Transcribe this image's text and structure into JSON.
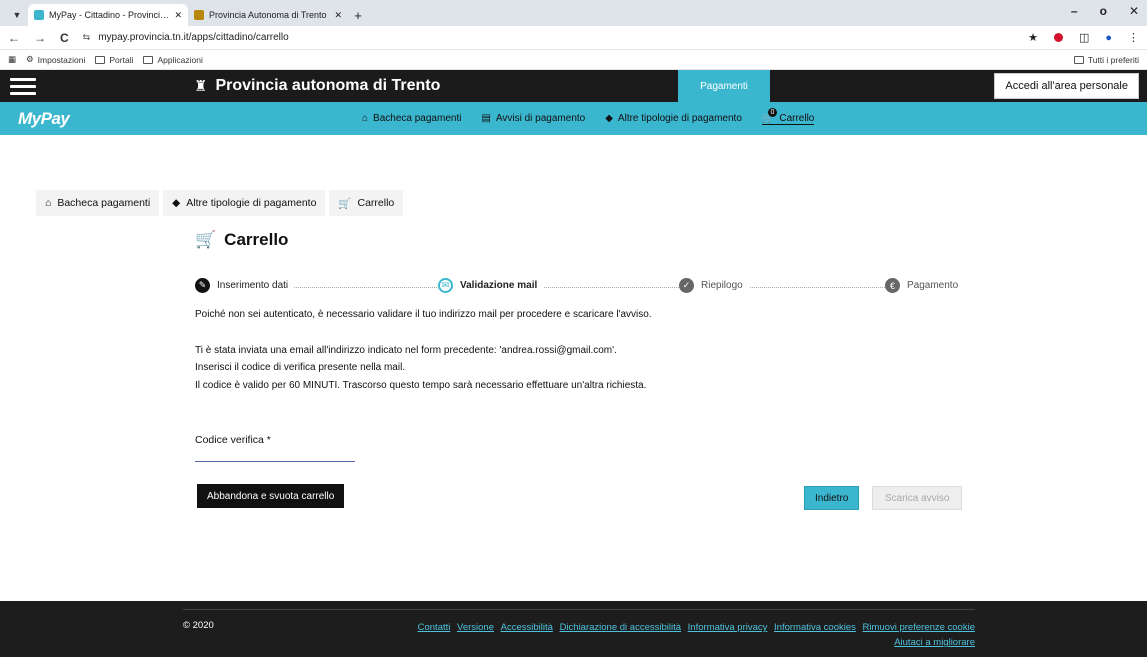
{
  "browser": {
    "tabs": [
      {
        "title": "MyPay - Cittadino - Provincia A",
        "active": true,
        "close": "✕"
      },
      {
        "title": "Provincia Autonoma di Trento",
        "active": false,
        "close": "✕"
      }
    ],
    "new_tab": "+",
    "url": "mypay.provincia.tn.it/apps/cittadino/carrello",
    "bookmarks": [
      {
        "label": "Impostazioni",
        "icon": "gear-icon"
      },
      {
        "label": "Portali",
        "icon": "folder-icon"
      },
      {
        "label": "Applicazioni",
        "icon": "folder-icon"
      }
    ],
    "bookmarks_right": "Tutti i preferiti"
  },
  "header": {
    "title": "Provincia autonoma di Trento",
    "section": "Pagamenti",
    "login": "Accedi all'area personale"
  },
  "mypay": {
    "logo": "MyPay",
    "nav": [
      {
        "label": "Bacheca pagamenti",
        "icon": "home-icon"
      },
      {
        "label": "Avvisi di pagamento",
        "icon": "document-icon"
      },
      {
        "label": "Altre tipologie di pagamento",
        "icon": "tag-icon"
      },
      {
        "label": "Carrello",
        "icon": "cart-icon",
        "badge": "0"
      }
    ]
  },
  "breadcrumb": [
    {
      "label": "Bacheca pagamenti",
      "icon": "home-icon"
    },
    {
      "label": "Altre tipologie di pagamento",
      "icon": "tag-icon"
    },
    {
      "label": "Carrello",
      "icon": "cart-icon"
    }
  ],
  "main": {
    "title": "Carrello",
    "steps": [
      {
        "label": "Inserimento dati",
        "state": "done"
      },
      {
        "label": "Validazione mail",
        "state": "active"
      },
      {
        "label": "Riepilogo",
        "state": "future"
      },
      {
        "label": "Pagamento",
        "state": "future"
      }
    ],
    "notice": "Poiché non sei autenticato, è necessario validare il tuo indirizzo mail per procedere e scaricare l'avviso.",
    "info_lines": [
      "Ti è stata inviata una email all'indirizzo indicato nel form precedente: 'andrea.rossi@gmail.com'.",
      "Inserisci il codice di verifica presente nella mail.",
      "Il codice è valido per 60 MINUTI. Trascorso questo tempo sarà necessario effettuare un'altra richiesta."
    ],
    "field_label": "Codice verifica *",
    "field_value": "",
    "btn_abandon": "Abbandona e svuota carrello",
    "btn_back": "Indietro",
    "btn_download": "Scarica avviso"
  },
  "footer": {
    "copyright": "© 2020",
    "links": [
      "Contatti",
      "Versione",
      "Accessibilità",
      "Dichiarazione di accessibilità",
      "Informativa privacy",
      "Informativa cookies",
      "Rimuovi preferenze cookie",
      "Aiutaci a migliorare"
    ]
  },
  "colors": {
    "accent": "#3bb6cf",
    "header_bg": "#1b1b1b",
    "footer_bg": "#1d1d1d",
    "link": "#4fc3dd"
  }
}
